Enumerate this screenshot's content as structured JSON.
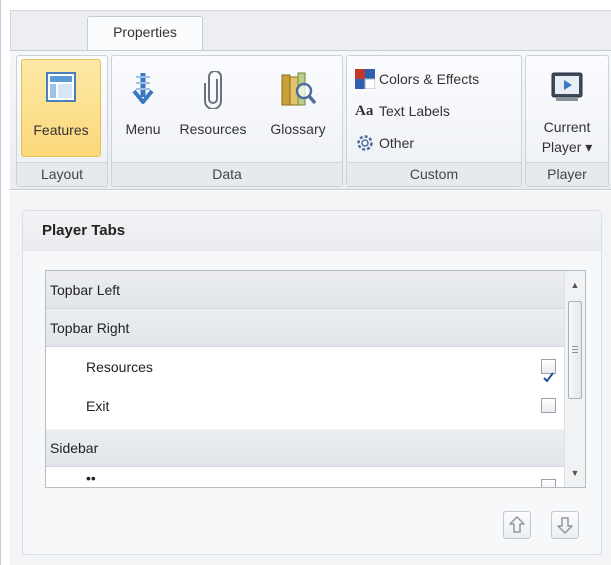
{
  "ribbon": {
    "tab_label": "Properties",
    "groups": {
      "layout": {
        "label": "Layout",
        "features": "Features"
      },
      "data": {
        "label": "Data",
        "menu": "Menu",
        "resources": "Resources",
        "glossary": "Glossary"
      },
      "custom": {
        "label": "Custom",
        "colors": "Colors & Effects",
        "text_labels": "Text Labels",
        "other": "Other"
      },
      "player": {
        "label": "Player",
        "current_player_line1": "Current",
        "current_player_line2": "Player ▾"
      }
    }
  },
  "panel": {
    "title": "Player Tabs",
    "rows": [
      {
        "label": "Topbar Left",
        "type": "group"
      },
      {
        "label": "Topbar Right",
        "type": "group"
      },
      {
        "label": "Resources",
        "type": "item",
        "checked": true
      },
      {
        "label": "Exit",
        "type": "item",
        "checked": false
      },
      {
        "label": "Sidebar",
        "type": "group"
      },
      {
        "label": "••",
        "type": "item",
        "checked": false
      }
    ]
  },
  "colors": {
    "accent_selected": "#fbd87a",
    "check_mark": "#2b4e9b"
  },
  "icons": {
    "features": "layout-icon",
    "menu": "menu-arrow-icon",
    "resources": "paperclip-icon",
    "glossary": "books-magnifier-icon",
    "colors": "color-swatch-icon",
    "other": "gear-icon",
    "current_player": "player-icon",
    "move_up": "arrow-up-icon",
    "move_down": "arrow-down-icon"
  }
}
